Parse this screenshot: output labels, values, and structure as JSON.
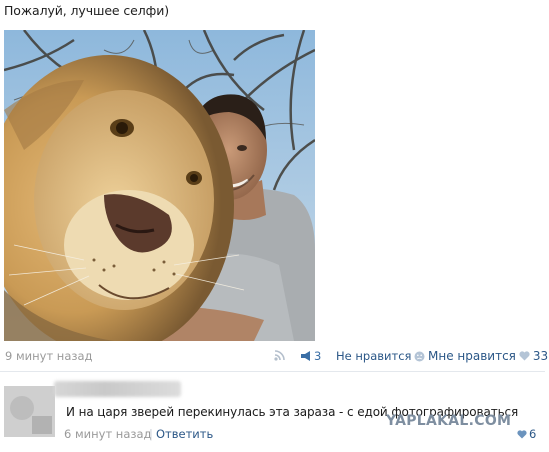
{
  "post": {
    "text": "Пожалуй, лучшее селфи)",
    "time": "9 минут назад",
    "share_count": "3",
    "dislike_label": "Не нравится",
    "like_label": "Мне нравится",
    "like_count": "33"
  },
  "comment": {
    "text": "И на царя зверей перекинулась эта зараза - с едой фотографироваться",
    "time": "6 минут назад",
    "separator": "|",
    "reply_label": "Ответить",
    "like_count": "6"
  },
  "watermark": "YAPLAKAL.COM",
  "icons": {
    "share": "rss-icon",
    "share_count": "megaphone-icon",
    "dislike": "frown-icon",
    "like": "heart-icon"
  },
  "colors": {
    "link": "#2b5787",
    "muted": "#9a9a9a",
    "accent": "#3a6ea5"
  }
}
